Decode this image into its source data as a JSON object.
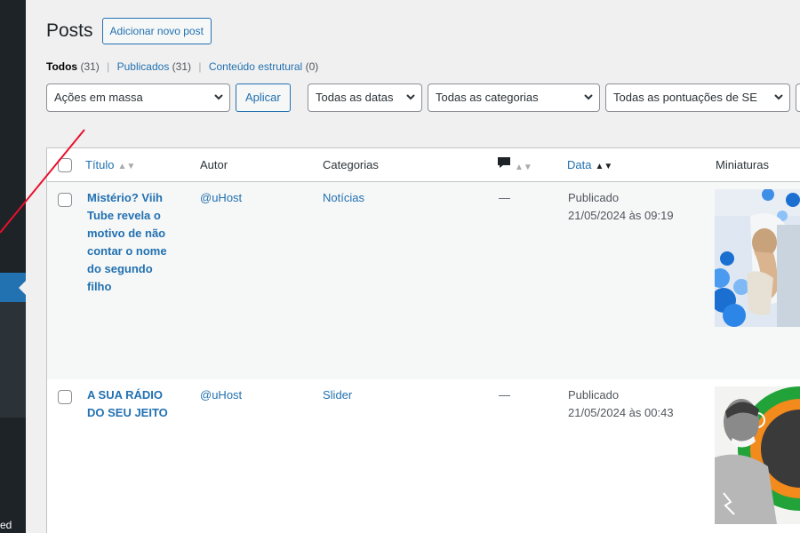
{
  "header": {
    "title": "Posts",
    "add_new_label": "Adicionar novo post"
  },
  "views": [
    {
      "label": "Todos",
      "count": "(31)"
    },
    {
      "label": "Publicados",
      "count": "(31)"
    },
    {
      "label": "Conteúdo estrutural",
      "count": "(0)"
    }
  ],
  "filters": {
    "bulk_actions": "Ações em massa",
    "apply_label": "Aplicar",
    "dates": "Todas as datas",
    "categories": "Todas as categorias",
    "seo_scores": "Todas as pontuações de SE"
  },
  "table": {
    "columns": {
      "title": "Título",
      "author": "Autor",
      "categories": "Categorias",
      "date": "Data",
      "thumbnails": "Miniaturas"
    },
    "rows": [
      {
        "title_lines": [
          "Mistério? Viih",
          "Tube revela o",
          "motivo de não",
          "contar o nome",
          "do segundo",
          "filho"
        ],
        "author": "@uHost",
        "category": "Notícias",
        "comments": "—",
        "status": "Publicado",
        "date": "21/05/2024 às 09:19"
      },
      {
        "title_lines": [
          "A SUA RÁDIO",
          "DO SEU JEITO"
        ],
        "author": "@uHost",
        "category": "Slider",
        "comments": "—",
        "status": "Publicado",
        "date": "21/05/2024 às 00:43"
      }
    ]
  },
  "sidebar": {
    "cut_text": "ed"
  },
  "colors": {
    "accent": "#2271b1",
    "sidebar": "#1d2327",
    "annotation": "#e8112d"
  }
}
